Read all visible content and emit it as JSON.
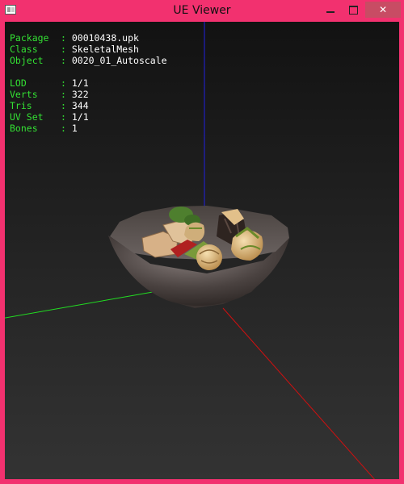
{
  "window": {
    "title": "UE Viewer",
    "close_symbol": "✕"
  },
  "info": {
    "object_rows": [
      {
        "key": "Package",
        "value": "00010438.upk"
      },
      {
        "key": "Class  ",
        "value": "SkeletalMesh"
      },
      {
        "key": "Object ",
        "value": "0020_01_Autoscale"
      }
    ],
    "stats_rows": [
      {
        "key": "LOD    ",
        "value": "1/1"
      },
      {
        "key": "Verts  ",
        "value": "322"
      },
      {
        "key": "Tris   ",
        "value": "344"
      },
      {
        "key": "UV Set ",
        "value": "1/1"
      },
      {
        "key": "Bones  ",
        "value": "1"
      }
    ]
  },
  "colors": {
    "label": "#33e033",
    "value": "#ffffff",
    "frame": "#f2316f",
    "axis_x": "#d01010",
    "axis_y": "#22dd22",
    "axis_z": "#2020e0"
  }
}
